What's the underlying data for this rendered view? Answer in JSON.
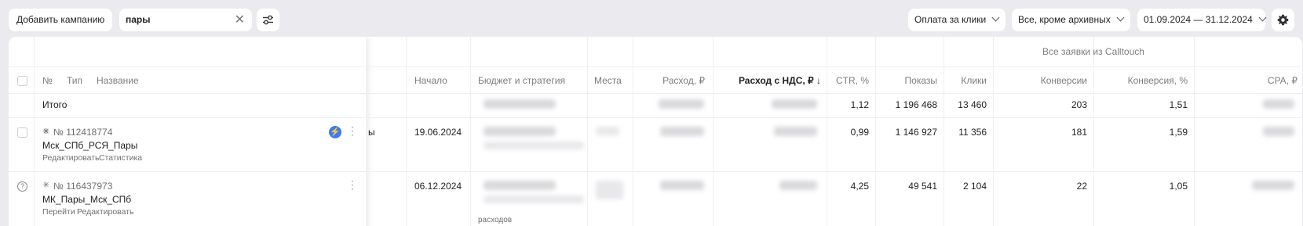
{
  "toolbar": {
    "add_campaign_label": "Добавить кампанию",
    "search_value": "пары",
    "clear_symbol": "✕",
    "payment_filter": "Оплата за клики",
    "status_filter": "Все, кроме архивных",
    "date_range": "01.09.2024 — 31.12.2024"
  },
  "table": {
    "group_header": "Все заявки из Calltouch",
    "columns": {
      "number": "№",
      "type": "Тип",
      "name": "Название",
      "start": "Начало",
      "budget": "Бюджет и стратегия",
      "places": "Места",
      "spend": "Расход, ₽",
      "spend_vat": "Расход с НДС, ₽ ↓",
      "ctr": "CTR, %",
      "impressions": "Показы",
      "clicks": "Клики",
      "conversions": "Конверсии",
      "conversion_rate": "Конверсия, %",
      "cpa": "CPA, ₽"
    },
    "total": {
      "label": "Итого",
      "ctr": "1,12",
      "impressions": "1 196 468",
      "clicks": "13 460",
      "conversions": "203",
      "conversion_rate": "1,51"
    },
    "rows": [
      {
        "number": "№ 112418774",
        "name": "Мск_СПб_РСЯ_Пары",
        "actions": [
          "Редактировать",
          "Статистика"
        ],
        "hidden_tail": "ы",
        "start": "19.06.2024",
        "ctr": "0,99",
        "impressions": "1 146 927",
        "clicks": "11 356",
        "conversions": "181",
        "conversion_rate": "1,59",
        "badge": "⚡"
      },
      {
        "number": "№ 116437973",
        "name": "МК_Пары_Мск_СПб",
        "actions": [
          "Перейти",
          "Редактировать"
        ],
        "start": "06.12.2024",
        "budget_note": "расходов",
        "ctr": "4,25",
        "impressions": "49 541",
        "clicks": "2 104",
        "conversions": "22",
        "conversion_rate": "1,05",
        "status_icon": "?"
      }
    ]
  },
  "icons": {
    "filter": "sliders-icon",
    "settings": "gear-icon",
    "campaign_type_1": "network-icon",
    "campaign_type_2": "sparkle-icon"
  },
  "colors": {
    "badge": "#3f7af5",
    "page_bg": "#ebebef"
  }
}
